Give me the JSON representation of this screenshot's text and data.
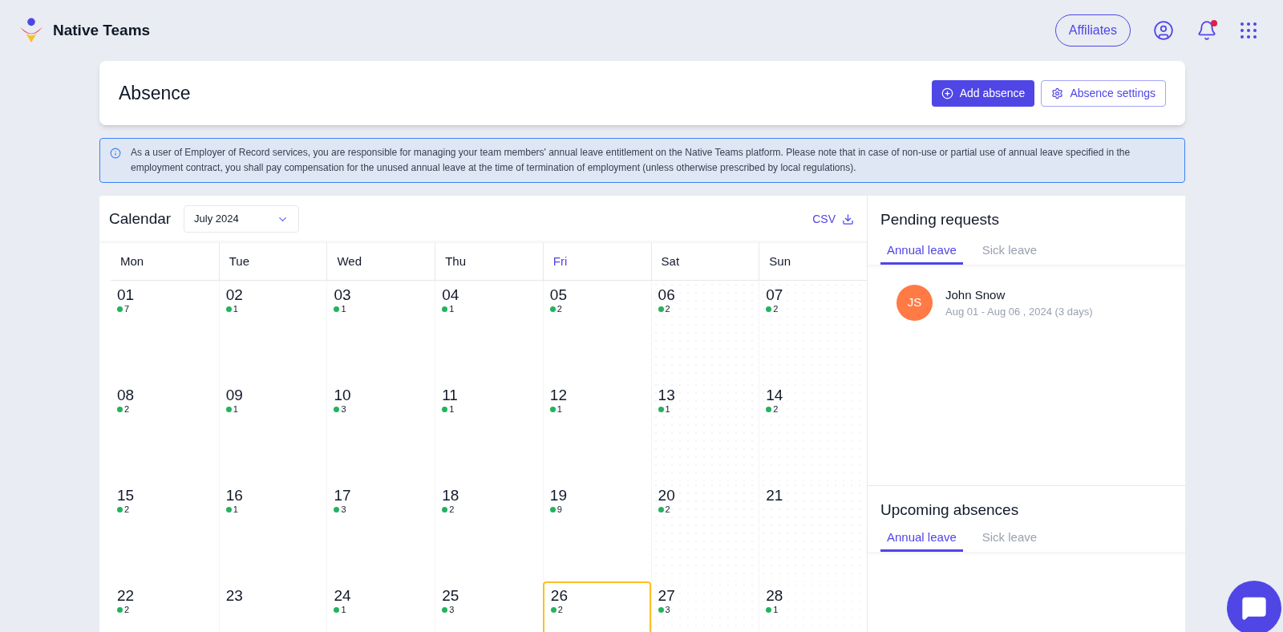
{
  "brand": {
    "name": "Native Teams"
  },
  "topbar": {
    "affiliates": "Affiliates",
    "notification_dot": true
  },
  "page": {
    "title": "Absence",
    "buttons": [
      {
        "kind": "primary",
        "label": "Add absence"
      },
      {
        "kind": "secondary",
        "label": "Absence settings"
      }
    ]
  },
  "notice": "As a user of Employer of Record services, you are responsible for managing your team members' annual leave entitlement on the Native Teams platform. Please note that in case of non-use or partial use of annual leave specified in the employment contract, you shall pay compensation for the unused annual leave at the time of termination of employment (unless otherwise prescribed by local regulations).",
  "calendar": {
    "title": "Calendar",
    "month": "July 2024",
    "export": "CSV",
    "weekdays": [
      {
        "label": "Mon",
        "selected": false
      },
      {
        "label": "Tue",
        "selected": false
      },
      {
        "label": "Wed",
        "selected": false
      },
      {
        "label": "Thu",
        "selected": false
      },
      {
        "label": "Fri",
        "selected": true
      },
      {
        "label": "Sat",
        "selected": false
      },
      {
        "label": "Sun",
        "selected": false
      }
    ],
    "days": [
      {
        "day": "01",
        "count": "7",
        "weekend": false,
        "today": false
      },
      {
        "day": "02",
        "count": "1",
        "weekend": false,
        "today": false
      },
      {
        "day": "03",
        "count": "1",
        "weekend": false,
        "today": false
      },
      {
        "day": "04",
        "count": "1",
        "weekend": false,
        "today": false
      },
      {
        "day": "05",
        "count": "2",
        "weekend": false,
        "today": false
      },
      {
        "day": "06",
        "count": "2",
        "weekend": true,
        "today": false
      },
      {
        "day": "07",
        "count": "2",
        "weekend": true,
        "today": false
      },
      {
        "day": "08",
        "count": "2",
        "weekend": false,
        "today": false
      },
      {
        "day": "09",
        "count": "1",
        "weekend": false,
        "today": false
      },
      {
        "day": "10",
        "count": "3",
        "weekend": false,
        "today": false
      },
      {
        "day": "11",
        "count": "1",
        "weekend": false,
        "today": false
      },
      {
        "day": "12",
        "count": "1",
        "weekend": false,
        "today": false
      },
      {
        "day": "13",
        "count": "1",
        "weekend": true,
        "today": false
      },
      {
        "day": "14",
        "count": "2",
        "weekend": true,
        "today": false
      },
      {
        "day": "15",
        "count": "2",
        "weekend": false,
        "today": false
      },
      {
        "day": "16",
        "count": "1",
        "weekend": false,
        "today": false
      },
      {
        "day": "17",
        "count": "3",
        "weekend": false,
        "today": false
      },
      {
        "day": "18",
        "count": "2",
        "weekend": false,
        "today": false
      },
      {
        "day": "19",
        "count": "9",
        "weekend": false,
        "today": false
      },
      {
        "day": "20",
        "count": "2",
        "weekend": true,
        "today": false
      },
      {
        "day": "21",
        "weekend": true,
        "today": false
      },
      {
        "day": "22",
        "count": "2",
        "weekend": false,
        "today": false
      },
      {
        "day": "23",
        "weekend": false,
        "today": false
      },
      {
        "day": "24",
        "count": "1",
        "weekend": false,
        "today": false
      },
      {
        "day": "25",
        "count": "3",
        "weekend": false,
        "today": false
      },
      {
        "day": "26",
        "count": "2",
        "weekend": false,
        "today": true
      },
      {
        "day": "27",
        "count": "3",
        "weekend": true,
        "today": false
      },
      {
        "day": "28",
        "count": "1",
        "weekend": true,
        "today": false
      }
    ]
  },
  "pending": {
    "title": "Pending requests",
    "tabs": [
      {
        "label": "Annual leave",
        "selected": true
      },
      {
        "label": "Sick leave",
        "selected": false
      }
    ],
    "requests": [
      {
        "initials": "JS",
        "name": "John Snow",
        "dates": "Aug 01 - Aug 06 , 2024 (3 days)"
      }
    ]
  },
  "upcoming": {
    "title": "Upcoming absences",
    "tabs": [
      {
        "label": "Annual leave",
        "selected": true
      },
      {
        "label": "Sick leave",
        "selected": false
      }
    ]
  }
}
